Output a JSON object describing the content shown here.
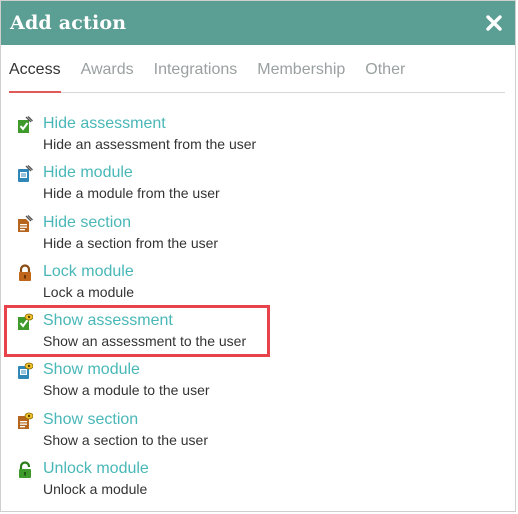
{
  "dialog": {
    "title": "Add action",
    "close_icon": "close-x-icon"
  },
  "tabs": [
    {
      "label": "Access",
      "active": true
    },
    {
      "label": "Awards",
      "active": false
    },
    {
      "label": "Integrations",
      "active": false
    },
    {
      "label": "Membership",
      "active": false
    },
    {
      "label": "Other",
      "active": false
    }
  ],
  "actions": [
    {
      "label": "Hide assessment",
      "description": "Hide an assessment from the user",
      "icon": "hide-assessment-icon"
    },
    {
      "label": "Hide module",
      "description": "Hide a module from the user",
      "icon": "hide-module-icon"
    },
    {
      "label": "Hide section",
      "description": "Hide a section from the user",
      "icon": "hide-section-icon"
    },
    {
      "label": "Lock module",
      "description": "Lock a module",
      "icon": "lock-icon"
    },
    {
      "label": "Show assessment",
      "description": "Show an assessment to the user",
      "icon": "show-assessment-icon",
      "highlighted": true
    },
    {
      "label": "Show module",
      "description": "Show a module to the user",
      "icon": "show-module-icon"
    },
    {
      "label": "Show section",
      "description": "Show a section to the user",
      "icon": "show-section-icon"
    },
    {
      "label": "Unlock module",
      "description": "Unlock a module",
      "icon": "unlock-icon"
    }
  ],
  "colors": {
    "header": "#5b9e94",
    "link": "#49b7b7",
    "active_tab_underline": "#e05a5a",
    "highlight_border": "#e8434a"
  }
}
